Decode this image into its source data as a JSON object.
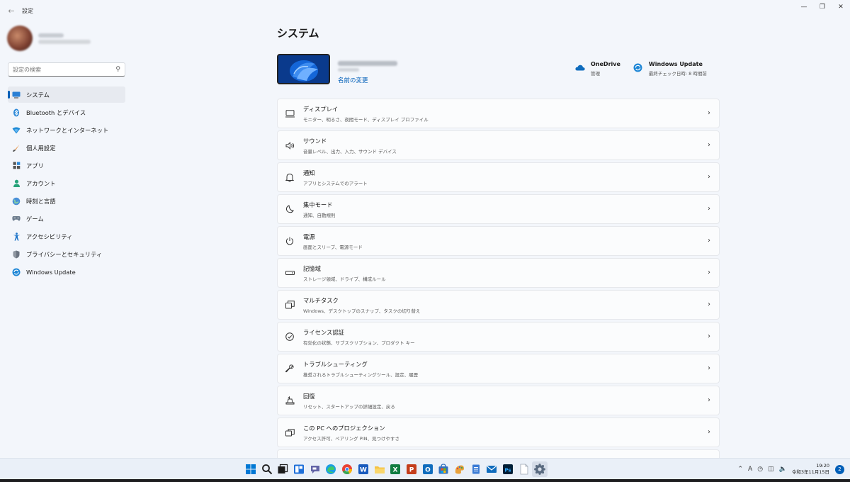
{
  "window": {
    "title": "設定"
  },
  "sidebar": {
    "search_placeholder": "設定の検索",
    "items": [
      {
        "label": "システム",
        "icon": "system-icon",
        "active": true
      },
      {
        "label": "Bluetooth とデバイス",
        "icon": "bluetooth-icon"
      },
      {
        "label": "ネットワークとインターネット",
        "icon": "network-icon"
      },
      {
        "label": "個人用設定",
        "icon": "personalization-icon"
      },
      {
        "label": "アプリ",
        "icon": "apps-icon"
      },
      {
        "label": "アカウント",
        "icon": "accounts-icon"
      },
      {
        "label": "時刻と言語",
        "icon": "time-language-icon"
      },
      {
        "label": "ゲーム",
        "icon": "gaming-icon"
      },
      {
        "label": "アクセシビリティ",
        "icon": "accessibility-icon"
      },
      {
        "label": "プライバシーとセキュリティ",
        "icon": "privacy-icon"
      },
      {
        "label": "Windows Update",
        "icon": "windows-update-icon"
      }
    ]
  },
  "main": {
    "title": "システム",
    "device": {
      "rename_label": "名前の変更"
    },
    "quick_links": [
      {
        "title": "OneDrive",
        "sub": "管理",
        "icon": "onedrive-icon"
      },
      {
        "title": "Windows Update",
        "sub": "最終チェック日時: 8 時間前",
        "icon": "update-icon"
      }
    ],
    "cards": [
      {
        "title": "ディスプレイ",
        "sub": "モニター、明るさ、夜間モード、ディスプレイ プロファイル",
        "icon": "display-icon"
      },
      {
        "title": "サウンド",
        "sub": "音量レベル、出力、入力、サウンド デバイス",
        "icon": "sound-icon"
      },
      {
        "title": "通知",
        "sub": "アプリとシステムでのアラート",
        "icon": "notifications-icon"
      },
      {
        "title": "集中モード",
        "sub": "通知、自動規則",
        "icon": "focus-icon"
      },
      {
        "title": "電源",
        "sub": "画面とスリープ、電源モード",
        "icon": "power-icon"
      },
      {
        "title": "記憶域",
        "sub": "ストレージ領域、ドライブ、構成ルール",
        "icon": "storage-icon"
      },
      {
        "title": "マルチタスク",
        "sub": "Windows、デスクトップのスナップ、タスクの切り替え",
        "icon": "multitasking-icon"
      },
      {
        "title": "ライセンス認証",
        "sub": "有効化の状態、サブスクリプション、プロダクト キー",
        "icon": "activation-icon"
      },
      {
        "title": "トラブルシューティング",
        "sub": "推奨されるトラブルシューティングツール、設定、履歴",
        "icon": "troubleshoot-icon"
      },
      {
        "title": "回復",
        "sub": "リセット、スタートアップの詳細設定、戻る",
        "icon": "recovery-icon"
      },
      {
        "title": "この PC へのプロジェクション",
        "sub": "アクセス許可、ペアリング PIN、見つけやすさ",
        "icon": "projection-icon"
      }
    ]
  },
  "taskbar": {
    "apps": [
      {
        "name": "start-icon",
        "color": "#0078d4"
      },
      {
        "name": "search-icon",
        "color": "#1a1a1a"
      },
      {
        "name": "task-view-icon",
        "color": "#1a1a1a"
      },
      {
        "name": "widgets-icon",
        "color": "#1e6fd9"
      },
      {
        "name": "chat-icon",
        "color": "#6264a7"
      },
      {
        "name": "edge-icon",
        "color": "#1b9de2"
      },
      {
        "name": "chrome-icon",
        "color": "#e94235"
      },
      {
        "name": "word-icon",
        "color": "#185abd",
        "letter": "W"
      },
      {
        "name": "file-explorer-icon",
        "color": "#f5c242"
      },
      {
        "name": "excel-icon",
        "color": "#107c41",
        "letter": "X"
      },
      {
        "name": "powerpoint-icon",
        "color": "#c43e1c",
        "letter": "P"
      },
      {
        "name": "outlook-icon",
        "color": "#0f6cbd",
        "letter": "O"
      },
      {
        "name": "store-icon",
        "color": "#2f6fbf"
      },
      {
        "name": "paint-icon",
        "color": "#e8a13a"
      },
      {
        "name": "notepad-icon",
        "color": "#3a7bd5"
      },
      {
        "name": "mail-icon",
        "color": "#0f6cbd"
      },
      {
        "name": "photoshop-icon",
        "color": "#001e36",
        "letter": "Ps"
      },
      {
        "name": "document-icon",
        "color": "#ffffff"
      },
      {
        "name": "settings-icon",
        "color": "#5a6b80",
        "active": true
      }
    ],
    "ime_label": "A",
    "time": "19:20",
    "date": "令和3年11月15日",
    "notification_count": "2"
  }
}
